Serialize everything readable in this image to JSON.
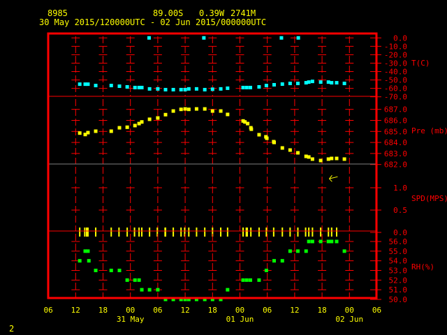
{
  "header": {
    "station": "8985",
    "latitude": "89.00S",
    "longitude": "0.39W",
    "elevation": "2741M",
    "time_range": "30 May 2015/120000UTC - 02 Jun 2015/000000UTC"
  },
  "footer": {
    "page_number": "2"
  },
  "colors": {
    "frame": "#ff0000",
    "text": "#ffff00",
    "temperature": "#00ffff",
    "pressure": "#ffff00",
    "wind": "#ffff00",
    "rh": "#00ff00",
    "separator_gray": "#808080"
  },
  "chart_data": {
    "type": "scatter",
    "x_unit": "hours since 30 May 2015 06UTC",
    "xlim": [
      0,
      72
    ],
    "x_ticks": [
      {
        "h": 0,
        "label": "06"
      },
      {
        "h": 6,
        "label": "12"
      },
      {
        "h": 12,
        "label": "18"
      },
      {
        "h": 18,
        "label": "00"
      },
      {
        "h": 24,
        "label": "06"
      },
      {
        "h": 30,
        "label": "12"
      },
      {
        "h": 36,
        "label": "18"
      },
      {
        "h": 42,
        "label": "00"
      },
      {
        "h": 48,
        "label": "06"
      },
      {
        "h": 54,
        "label": "12"
      },
      {
        "h": 60,
        "label": "18"
      },
      {
        "h": 66,
        "label": "00"
      },
      {
        "h": 72,
        "label": "06"
      }
    ],
    "date_labels": [
      {
        "h": 18,
        "label": "31 May"
      },
      {
        "h": 42,
        "label": "01 Jun"
      },
      {
        "h": 66,
        "label": "02 Jun"
      }
    ],
    "panels": [
      {
        "name": "temperature",
        "axis_label": "T(C)",
        "ylim": [
          -70,
          0
        ],
        "color": "#00ffff",
        "y_ticks": [
          {
            "v": 0,
            "label": "0.0"
          },
          {
            "v": -10,
            "label": "-10.0"
          },
          {
            "v": -20,
            "label": "-20.0"
          },
          {
            "v": -30,
            "label": "-30.0"
          },
          {
            "v": -40,
            "label": "-40.0"
          },
          {
            "v": -50,
            "label": "-50.0"
          },
          {
            "v": -60,
            "label": "-60.0"
          },
          {
            "v": -70,
            "label": "-70.0"
          }
        ],
        "points": [
          [
            6.9,
            -55
          ],
          [
            8.1,
            -55
          ],
          [
            8.7,
            -55
          ],
          [
            10.4,
            -56.6
          ],
          [
            13.8,
            -56.6
          ],
          [
            15.6,
            -57.4
          ],
          [
            17.3,
            -58.2
          ],
          [
            19.0,
            -59
          ],
          [
            19.9,
            -59
          ],
          [
            20.5,
            -59
          ],
          [
            22.1,
            0
          ],
          [
            22.2,
            -60.6
          ],
          [
            24.0,
            -60.6
          ],
          [
            25.7,
            -61.5
          ],
          [
            27.4,
            -61.5
          ],
          [
            29.1,
            -61.5
          ],
          [
            30.0,
            -61.5
          ],
          [
            30.8,
            -60.6
          ],
          [
            32.5,
            -60.6
          ],
          [
            34.1,
            0
          ],
          [
            34.3,
            -61.5
          ],
          [
            36.0,
            -61
          ],
          [
            37.8,
            -60.6
          ],
          [
            39.3,
            -59.8
          ],
          [
            42.7,
            -59
          ],
          [
            43.5,
            -59
          ],
          [
            44.3,
            -59
          ],
          [
            46.2,
            -58.2
          ],
          [
            47.8,
            -56.6
          ],
          [
            49.5,
            -55.7
          ],
          [
            51.1,
            0
          ],
          [
            51.3,
            -54.9
          ],
          [
            53.0,
            -54.1
          ],
          [
            54.7,
            -54.1
          ],
          [
            54.8,
            0
          ],
          [
            56.5,
            -53.3
          ],
          [
            57.1,
            -52.5
          ],
          [
            57.9,
            -51.7
          ],
          [
            59.7,
            -52.5
          ],
          [
            61.4,
            -52.5
          ],
          [
            62.1,
            -53.3
          ],
          [
            63.2,
            -53.3
          ],
          [
            64.9,
            -54.1
          ]
        ]
      },
      {
        "name": "pressure",
        "axis_label": "Pre (mb)",
        "ylim": [
          682,
          687
        ],
        "color": "#ffff00",
        "y_ticks": [
          {
            "v": 687,
            "label": "687.0"
          },
          {
            "v": 686,
            "label": "686.0"
          },
          {
            "v": 685,
            "label": "685.0"
          },
          {
            "v": 684,
            "label": "684.0"
          },
          {
            "v": 683,
            "label": "683.0"
          },
          {
            "v": 682,
            "label": "682.0"
          }
        ],
        "points": [
          [
            6.9,
            684.85
          ],
          [
            8.1,
            684.72
          ],
          [
            8.7,
            684.89
          ],
          [
            10.4,
            685.02
          ],
          [
            13.8,
            685.02
          ],
          [
            15.6,
            685.33
          ],
          [
            17.3,
            685.38
          ],
          [
            19.0,
            685.53
          ],
          [
            19.9,
            685.71
          ],
          [
            20.5,
            685.86
          ],
          [
            22.2,
            686.1
          ],
          [
            24.0,
            686.22
          ],
          [
            25.7,
            686.52
          ],
          [
            27.4,
            686.85
          ],
          [
            29.1,
            687.0
          ],
          [
            30.0,
            687.04
          ],
          [
            30.8,
            687.0
          ],
          [
            32.5,
            687.04
          ],
          [
            34.3,
            687.04
          ],
          [
            36.0,
            686.85
          ],
          [
            37.8,
            686.85
          ],
          [
            39.3,
            686.54
          ],
          [
            42.7,
            685.95
          ],
          [
            43.1,
            685.86
          ],
          [
            43.7,
            685.71
          ],
          [
            44.4,
            685.33
          ],
          [
            44.5,
            685.2
          ],
          [
            46.2,
            684.7
          ],
          [
            47.7,
            684.51
          ],
          [
            47.9,
            684.38
          ],
          [
            49.4,
            684.07
          ],
          [
            49.5,
            684.0
          ],
          [
            51.3,
            683.5
          ],
          [
            53.0,
            683.31
          ],
          [
            54.7,
            683.06
          ],
          [
            56.5,
            682.74
          ],
          [
            57.1,
            682.68
          ],
          [
            57.9,
            682.49
          ],
          [
            59.7,
            682.36
          ],
          [
            61.4,
            682.49
          ],
          [
            62.1,
            682.55
          ],
          [
            63.2,
            682.55
          ],
          [
            64.9,
            682.49
          ]
        ]
      },
      {
        "name": "wind_speed",
        "axis_label": "SPD(MPS)",
        "ylim": [
          0,
          1.5
        ],
        "color": "#ffff00",
        "y_ticks": [
          {
            "v": 1.0,
            "label": "1.0"
          },
          {
            "v": 0.5,
            "label": "0.5"
          },
          {
            "v": 0,
            "label": "0.0"
          }
        ],
        "points": [
          [
            6.9,
            0
          ],
          [
            8.0,
            0
          ],
          [
            8.4,
            0
          ],
          [
            8.7,
            0
          ],
          [
            10.4,
            0
          ],
          [
            13.8,
            0
          ],
          [
            15.5,
            0
          ],
          [
            17.3,
            0
          ],
          [
            18.9,
            0
          ],
          [
            19.9,
            0
          ],
          [
            20.5,
            0
          ],
          [
            22.2,
            0
          ],
          [
            23.9,
            0
          ],
          [
            25.6,
            0
          ],
          [
            25.7,
            0
          ],
          [
            27.4,
            0
          ],
          [
            29.1,
            0
          ],
          [
            29.9,
            0
          ],
          [
            30.8,
            0
          ],
          [
            32.5,
            0
          ],
          [
            34.3,
            0
          ],
          [
            36.0,
            0
          ],
          [
            37.8,
            0
          ],
          [
            39.3,
            0
          ],
          [
            42.7,
            0
          ],
          [
            43.4,
            0
          ],
          [
            43.6,
            0
          ],
          [
            44.4,
            0
          ],
          [
            46.2,
            0
          ],
          [
            47.8,
            0
          ],
          [
            49.4,
            0
          ],
          [
            51.3,
            0
          ],
          [
            53.0,
            0
          ],
          [
            54.7,
            0
          ],
          [
            56.4,
            0
          ],
          [
            57.1,
            0
          ],
          [
            57.9,
            0
          ],
          [
            59.7,
            0
          ],
          [
            61.4,
            0
          ],
          [
            62.1,
            0
          ],
          [
            63.2,
            0
          ]
        ],
        "wind_direction_arrow": {
          "h": 62.5,
          "v": 1.2
        }
      },
      {
        "name": "relative_humidity",
        "axis_label": "RH(%)",
        "ylim": [
          50,
          56
        ],
        "color": "#00ff00",
        "y_ticks": [
          {
            "v": 56,
            "label": "56.0"
          },
          {
            "v": 55,
            "label": "55.0"
          },
          {
            "v": 54,
            "label": "54.0"
          },
          {
            "v": 53,
            "label": "53.0"
          },
          {
            "v": 52,
            "label": "52.0"
          },
          {
            "v": 51,
            "label": "51.0"
          },
          {
            "v": 50,
            "label": "50.0"
          }
        ],
        "points": [
          [
            6.9,
            54
          ],
          [
            8.1,
            55
          ],
          [
            8.7,
            55
          ],
          [
            8.9,
            54
          ],
          [
            10.4,
            53
          ],
          [
            13.8,
            53
          ],
          [
            15.6,
            53
          ],
          [
            17.3,
            52
          ],
          [
            19.0,
            52
          ],
          [
            19.9,
            52
          ],
          [
            20.5,
            51
          ],
          [
            22.2,
            51
          ],
          [
            24.0,
            51
          ],
          [
            25.7,
            50
          ],
          [
            27.4,
            50
          ],
          [
            29.1,
            50
          ],
          [
            30.0,
            50
          ],
          [
            30.8,
            50
          ],
          [
            32.5,
            50
          ],
          [
            34.3,
            50
          ],
          [
            36.0,
            50
          ],
          [
            37.8,
            50
          ],
          [
            39.3,
            51
          ],
          [
            42.7,
            52
          ],
          [
            43.5,
            52
          ],
          [
            44.3,
            52
          ],
          [
            46.2,
            52
          ],
          [
            47.8,
            53
          ],
          [
            49.5,
            54
          ],
          [
            51.3,
            54
          ],
          [
            53.0,
            55
          ],
          [
            54.7,
            55
          ],
          [
            56.5,
            55
          ],
          [
            57.1,
            56
          ],
          [
            57.9,
            56
          ],
          [
            59.7,
            56
          ],
          [
            61.4,
            56
          ],
          [
            62.1,
            56
          ],
          [
            63.2,
            56
          ],
          [
            64.9,
            55
          ]
        ]
      }
    ]
  }
}
